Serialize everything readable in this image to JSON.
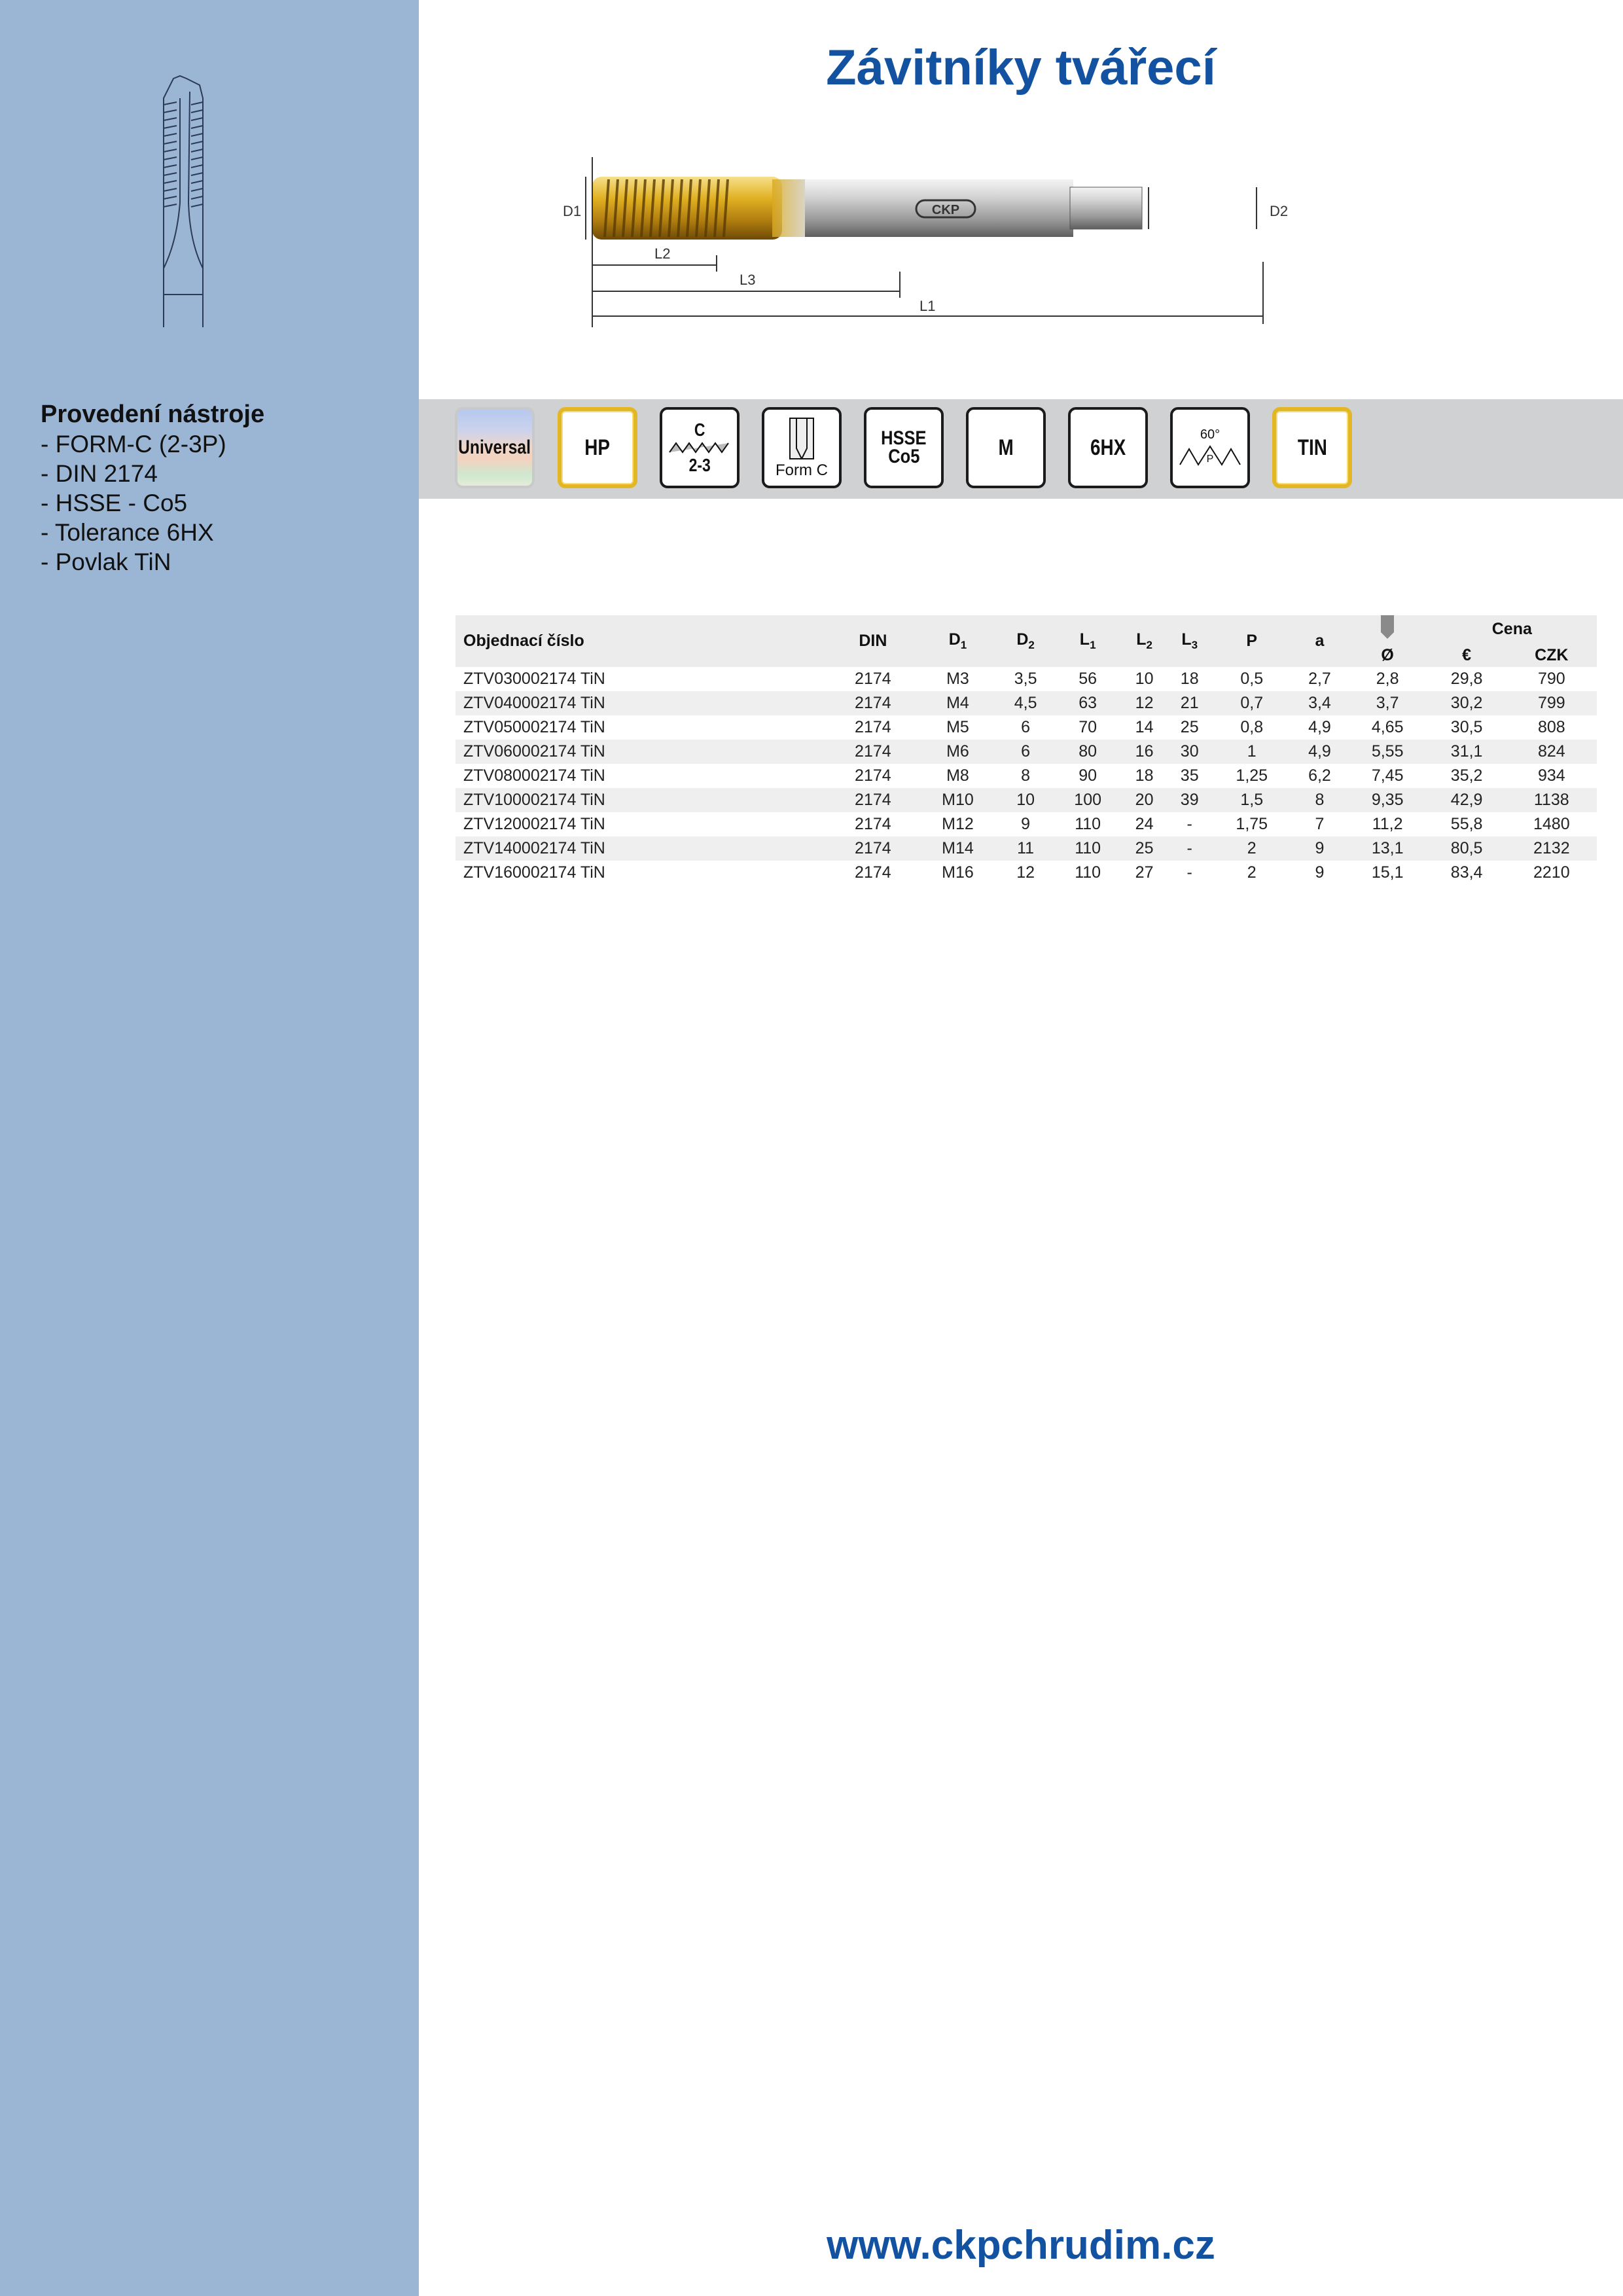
{
  "title": "Závitníky tvářecí",
  "spec": {
    "heading": "Provedení nástroje",
    "items": [
      "- FORM-C (2-3P)",
      "- DIN 2174",
      "- HSSE - Co5",
      "- Tolerance 6HX",
      "- Povlak TiN"
    ]
  },
  "drawing_labels": {
    "d1": "D1",
    "d2": "D2",
    "l1": "L1",
    "l2": "L2",
    "l3": "L3",
    "logo": "CKP"
  },
  "badges": {
    "universal": "Universal",
    "hp": "HP",
    "chamfer_letter": "C",
    "chamfer_threads": "2-3",
    "form": "Form C",
    "material_line1": "HSSE",
    "material_line2": "Co5",
    "thread_type": "M",
    "tolerance": "6HX",
    "angle": "60°",
    "pitch_letter": "P",
    "coating": "TIN"
  },
  "table": {
    "headers": {
      "code": "Objednací číslo",
      "din": "DIN",
      "d1": "D",
      "d1_sub": "1",
      "d2": "D",
      "d2_sub": "2",
      "l1": "L",
      "l1_sub": "1",
      "l2": "L",
      "l2_sub": "2",
      "l3": "L",
      "l3_sub": "3",
      "p": "P",
      "a": "a",
      "drill": "Ø",
      "price": "Cena",
      "eur": "€",
      "czk": "CZK"
    },
    "rows": [
      [
        "ZTV030002174 TiN",
        "2174",
        "M3",
        "3,5",
        "56",
        "10",
        "18",
        "0,5",
        "2,7",
        "2,8",
        "29,8",
        "790"
      ],
      [
        "ZTV040002174 TiN",
        "2174",
        "M4",
        "4,5",
        "63",
        "12",
        "21",
        "0,7",
        "3,4",
        "3,7",
        "30,2",
        "799"
      ],
      [
        "ZTV050002174 TiN",
        "2174",
        "M5",
        "6",
        "70",
        "14",
        "25",
        "0,8",
        "4,9",
        "4,65",
        "30,5",
        "808"
      ],
      [
        "ZTV060002174 TiN",
        "2174",
        "M6",
        "6",
        "80",
        "16",
        "30",
        "1",
        "4,9",
        "5,55",
        "31,1",
        "824"
      ],
      [
        "ZTV080002174 TiN",
        "2174",
        "M8",
        "8",
        "90",
        "18",
        "35",
        "1,25",
        "6,2",
        "7,45",
        "35,2",
        "934"
      ],
      [
        "ZTV100002174 TiN",
        "2174",
        "M10",
        "10",
        "100",
        "20",
        "39",
        "1,5",
        "8",
        "9,35",
        "42,9",
        "1138"
      ],
      [
        "ZTV120002174 TiN",
        "2174",
        "M12",
        "9",
        "110",
        "24",
        "-",
        "1,75",
        "7",
        "11,2",
        "55,8",
        "1480"
      ],
      [
        "ZTV140002174 TiN",
        "2174",
        "M14",
        "11",
        "110",
        "25",
        "-",
        "2",
        "9",
        "13,1",
        "80,5",
        "2132"
      ],
      [
        "ZTV160002174 TiN",
        "2174",
        "M16",
        "12",
        "110",
        "27",
        "-",
        "2",
        "9",
        "15,1",
        "83,4",
        "2210"
      ]
    ]
  },
  "footer": "www.ckpchrudim.cz",
  "colors": {
    "sidebar": "#9bb6d5",
    "accent": "#1352a0",
    "band": "#d0d1d3",
    "gold": "#e2b624"
  }
}
